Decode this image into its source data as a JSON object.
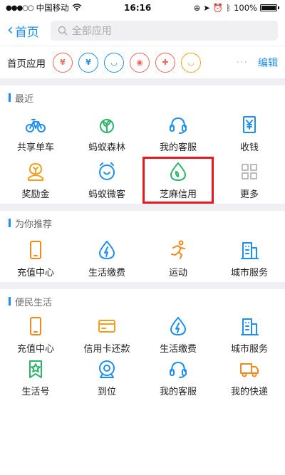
{
  "status_bar": {
    "carrier": "中国移动",
    "time": "16:16",
    "battery": "100%"
  },
  "nav": {
    "back_label": "首页",
    "search_placeholder": "全部应用"
  },
  "shortcut": {
    "label": "首页应用",
    "edit_label": "编辑",
    "more": "···"
  },
  "sections": [
    {
      "title": "最近",
      "items": [
        {
          "label": "共享单车",
          "icon": "bike-icon",
          "color": "#1f8ef1"
        },
        {
          "label": "蚂蚁森林",
          "icon": "sprout-icon",
          "color": "#2db36a"
        },
        {
          "label": "我的客服",
          "icon": "headset-icon",
          "color": "#1f8ef1"
        },
        {
          "label": "收钱",
          "icon": "yen-receipt-icon",
          "color": "#1f8ef1"
        },
        {
          "label": "奖励金",
          "icon": "reward-icon",
          "color": "#f0a020"
        },
        {
          "label": "蚂蚁微客",
          "icon": "alarm-smile-icon",
          "color": "#1f8ef1"
        },
        {
          "label": "芝麻信用",
          "icon": "sesame-drop-icon",
          "color": "#2db36a",
          "highlighted": true
        },
        {
          "label": "更多",
          "icon": "grid-more-icon",
          "color": "#bbbbbb"
        }
      ]
    },
    {
      "title": "为你推荐",
      "items": [
        {
          "label": "充值中心",
          "icon": "phone-icon",
          "color": "#f08a20"
        },
        {
          "label": "生活缴费",
          "icon": "bolt-drop-icon",
          "color": "#1f8ef1"
        },
        {
          "label": "运动",
          "icon": "runner-icon",
          "color": "#f08a20"
        },
        {
          "label": "城市服务",
          "icon": "building-icon",
          "color": "#1f8ef1"
        }
      ]
    },
    {
      "title": "便民生活",
      "items": [
        {
          "label": "充值中心",
          "icon": "phone-icon",
          "color": "#f08a20"
        },
        {
          "label": "信用卡还款",
          "icon": "card-icon",
          "color": "#f0a020"
        },
        {
          "label": "生活缴费",
          "icon": "bolt-drop-icon",
          "color": "#1f8ef1"
        },
        {
          "label": "城市服务",
          "icon": "building-icon",
          "color": "#1f8ef1"
        },
        {
          "label": "生活号",
          "icon": "star-bookmark-icon",
          "color": "#2db36a"
        },
        {
          "label": "到位",
          "icon": "location-ring-icon",
          "color": "#1f8ef1"
        },
        {
          "label": "我的客服",
          "icon": "headset-icon",
          "color": "#1f8ef1"
        },
        {
          "label": "我的快递",
          "icon": "truck-icon",
          "color": "#f08a20"
        }
      ]
    }
  ],
  "mini_icons": [
    {
      "icon": "yen-bag-icon",
      "color": "#f06a5a",
      "glyph": "¥"
    },
    {
      "icon": "yen-circle-icon",
      "color": "#1f8ef1",
      "glyph": "¥"
    },
    {
      "icon": "alarm-icon",
      "color": "#1f8ef1",
      "glyph": "◡"
    },
    {
      "icon": "glasses-face-icon",
      "color": "#f06a5a",
      "glyph": "◉"
    },
    {
      "icon": "gamepad-icon",
      "color": "#f06a5a",
      "glyph": "✚"
    },
    {
      "icon": "cup-icon",
      "color": "#f0a020",
      "glyph": "◡"
    }
  ]
}
